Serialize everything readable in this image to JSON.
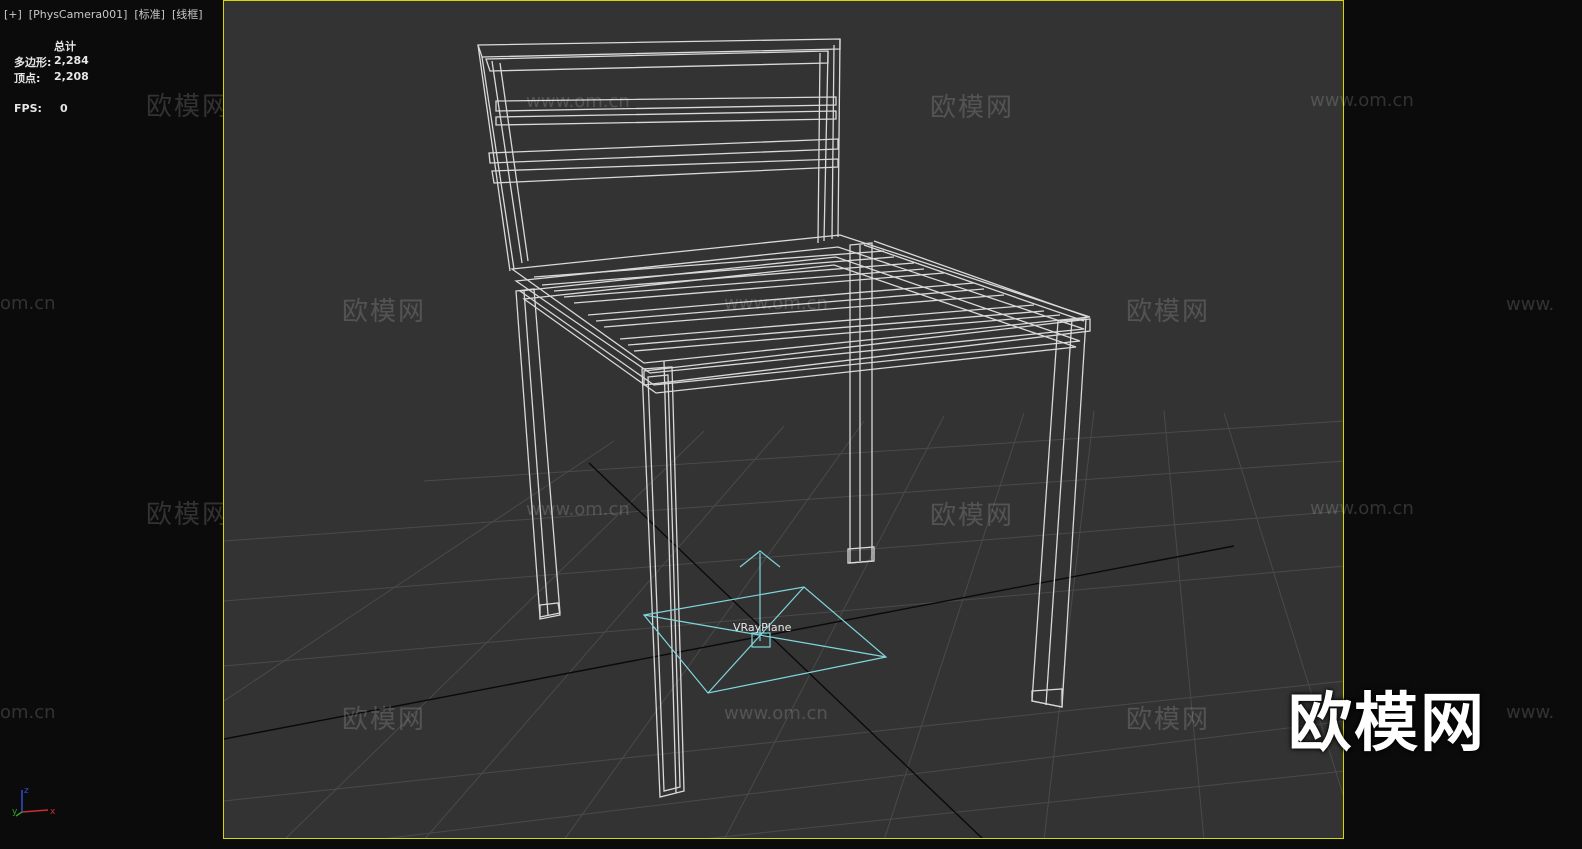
{
  "viewport": {
    "label": "[+]  [PhysCamera001]  [标准]  [线框]"
  },
  "stats": {
    "header": "总计",
    "polys_label": "多边形:",
    "polys_value": "2,284",
    "verts_label": "顶点:",
    "verts_value": "2,208",
    "fps_label": "FPS:",
    "fps_value": "0"
  },
  "scene": {
    "object_label": "VRayPlane"
  },
  "watermark": {
    "cn": "欧模网",
    "url": "www.om.cn",
    "url_partial_left": "om.cn",
    "url_partial_right": "www.",
    "logo": "欧模网"
  },
  "axis": {
    "x": "x",
    "y": "y",
    "z": "z"
  },
  "colors": {
    "viewport_bg": "#333333",
    "viewport_border": "#d6d600",
    "wireframe": "#d9d9d9",
    "selection": "#7fd6dc",
    "grid": "#4a4a4a"
  }
}
